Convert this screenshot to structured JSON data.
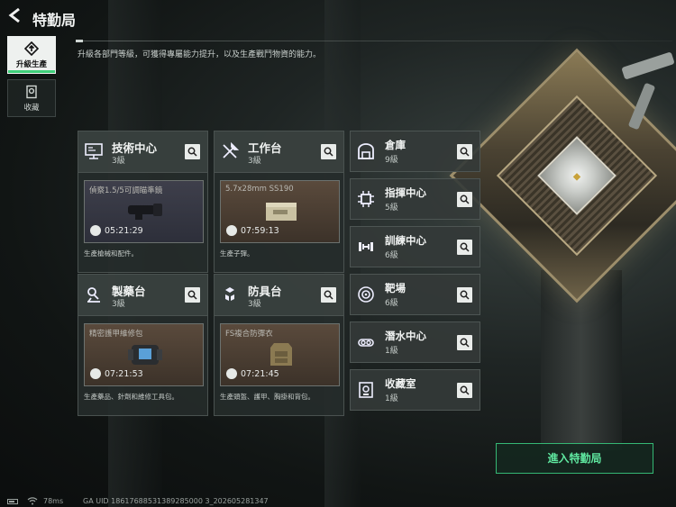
{
  "header": {
    "title": "特勤局",
    "subtitle": "升級各部門等級，可獲得專屬能力提升，以及生產戰鬥物資的能力。"
  },
  "side_tabs": [
    {
      "label": "升級生產",
      "icon": "upgrade-icon",
      "active": true
    },
    {
      "label": "收藏",
      "icon": "collection-icon",
      "active": false
    }
  ],
  "cards": [
    {
      "name": "技術中心",
      "level": "3級",
      "icon": "computer-icon",
      "slot_item": "偵察1.5/5可調瞄準鏡",
      "timer": "05:21:29",
      "desc": "生產槍械和配件。",
      "slot_theme": "purple"
    },
    {
      "name": "工作台",
      "level": "3級",
      "icon": "tools-icon",
      "slot_item": "5.7x28mm SS190",
      "timer": "07:59:13",
      "desc": "生產子彈。",
      "slot_theme": "brown"
    },
    {
      "name": "製藥台",
      "level": "3級",
      "icon": "microscope-icon",
      "slot_item": "精密護甲維修包",
      "timer": "07:21:53",
      "desc": "生產藥品、針劑和維修工具包。",
      "slot_theme": "brown"
    },
    {
      "name": "防具台",
      "level": "3級",
      "icon": "armor-blocks-icon",
      "slot_item": "FS複合防彈衣",
      "timer": "07:21:45",
      "desc": "生產頭盔、護甲、胸掛和背包。",
      "slot_theme": "brown"
    }
  ],
  "rows": [
    {
      "name": "倉庫",
      "level": "9級",
      "icon": "warehouse-icon"
    },
    {
      "name": "指揮中心",
      "level": "5級",
      "icon": "chip-icon"
    },
    {
      "name": "訓練中心",
      "level": "6級",
      "icon": "dumbbell-icon"
    },
    {
      "name": "靶場",
      "level": "6級",
      "icon": "target-icon"
    },
    {
      "name": "潛水中心",
      "level": "1級",
      "icon": "diving-icon"
    },
    {
      "name": "收藏室",
      "level": "1級",
      "icon": "safe-icon"
    }
  ],
  "enter_button": "進入特勤局",
  "status_bar": {
    "ping": "78ms",
    "uid": "GA UID 18617688531389285000 3_202605281347"
  },
  "colors": {
    "accent_green": "#3fcf7a",
    "enter_text": "#5fe8a0",
    "panel": "#262c2b"
  }
}
